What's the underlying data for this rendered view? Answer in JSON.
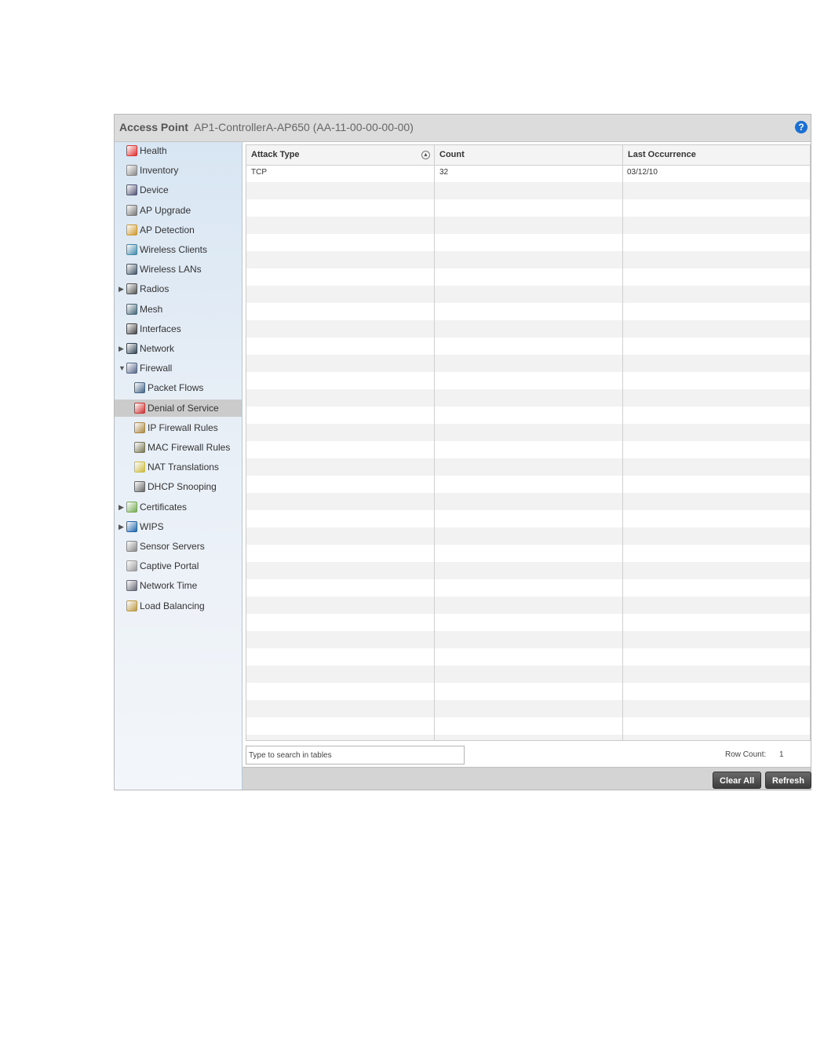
{
  "header": {
    "title": "Access Point",
    "subtitle": "AP1-ControllerA-AP650 (AA-11-00-00-00-00)",
    "help_glyph": "?"
  },
  "sidebar": {
    "items": [
      {
        "label": "Health",
        "icon": "health-icon"
      },
      {
        "label": "Inventory",
        "icon": "inventory-icon"
      },
      {
        "label": "Device",
        "icon": "device-icon"
      },
      {
        "label": "AP Upgrade",
        "icon": "ap-upgrade-icon"
      },
      {
        "label": "AP Detection",
        "icon": "ap-detection-icon"
      },
      {
        "label": "Wireless Clients",
        "icon": "wireless-clients-icon"
      },
      {
        "label": "Wireless LANs",
        "icon": "wireless-lans-icon"
      },
      {
        "label": "Radios",
        "icon": "radios-icon",
        "expander": "collapsed"
      },
      {
        "label": "Mesh",
        "icon": "mesh-icon"
      },
      {
        "label": "Interfaces",
        "icon": "interfaces-icon"
      },
      {
        "label": "Network",
        "icon": "network-icon",
        "expander": "collapsed"
      },
      {
        "label": "Firewall",
        "icon": "firewall-icon",
        "expander": "expanded"
      },
      {
        "label": "Packet Flows",
        "icon": "packet-flows-icon",
        "child": true
      },
      {
        "label": "Denial of Service",
        "icon": "denial-of-service-icon",
        "child": true,
        "selected": true
      },
      {
        "label": "IP Firewall Rules",
        "icon": "ip-firewall-rules-icon",
        "child": true
      },
      {
        "label": "MAC Firewall Rules",
        "icon": "mac-firewall-rules-icon",
        "child": true
      },
      {
        "label": "NAT Translations",
        "icon": "nat-translations-icon",
        "child": true
      },
      {
        "label": "DHCP Snooping",
        "icon": "dhcp-snooping-icon",
        "child": true
      },
      {
        "label": "Certificates",
        "icon": "certificates-icon",
        "expander": "collapsed"
      },
      {
        "label": "WIPS",
        "icon": "wips-icon",
        "expander": "collapsed"
      },
      {
        "label": "Sensor Servers",
        "icon": "sensor-servers-icon"
      },
      {
        "label": "Captive Portal",
        "icon": "captive-portal-icon"
      },
      {
        "label": "Network Time",
        "icon": "network-time-icon"
      },
      {
        "label": "Load Balancing",
        "icon": "load-balancing-icon"
      }
    ]
  },
  "table": {
    "columns": [
      "Attack Type",
      "Count",
      "Last Occurrence"
    ],
    "rows": [
      [
        "TCP",
        "32",
        "03/12/10"
      ]
    ]
  },
  "search": {
    "placeholder": "Type to search in tables"
  },
  "row_count": {
    "label": "Row Count:",
    "value": "1"
  },
  "buttons": {
    "clear_all": "Clear All",
    "refresh": "Refresh"
  },
  "colors": {
    "selected_row": "#cbcbcb",
    "help_blue": "#1a6fd0",
    "button_dark": "#4a4a4a"
  }
}
